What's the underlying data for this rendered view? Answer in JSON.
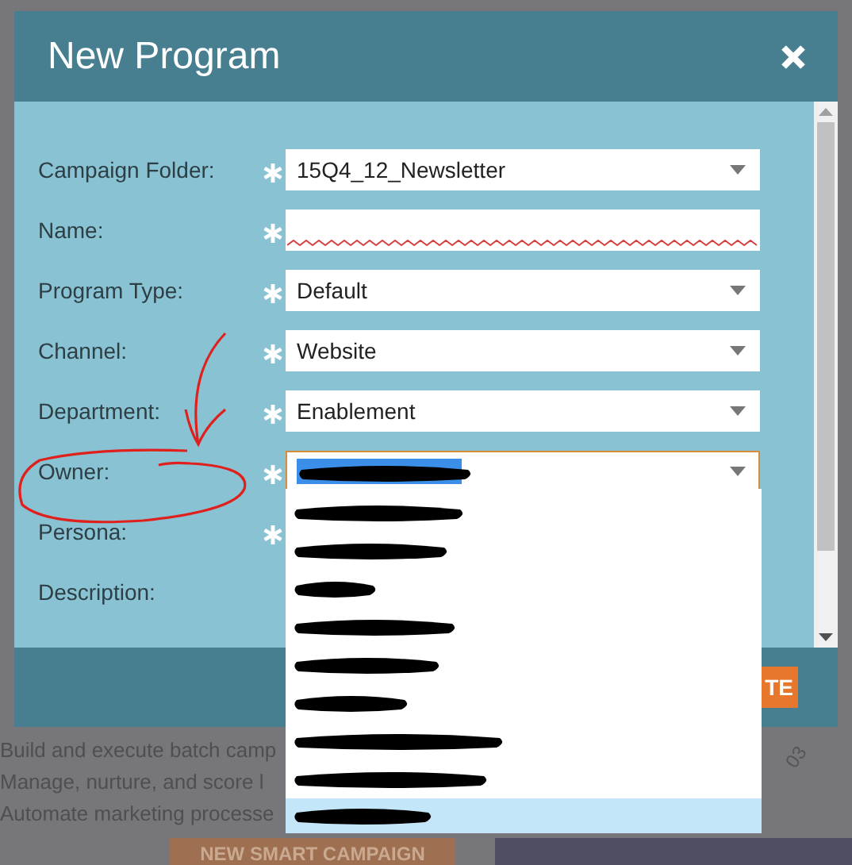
{
  "dialog": {
    "title": "New Program",
    "fields": [
      {
        "label": "Campaign Folder:",
        "required": true,
        "kind": "select",
        "value": "15Q4_12_Newsletter"
      },
      {
        "label": "Name:",
        "required": true,
        "kind": "text",
        "invalid": true
      },
      {
        "label": "Program Type:",
        "required": true,
        "kind": "select",
        "value": "Default"
      },
      {
        "label": "Channel:",
        "required": true,
        "kind": "select",
        "value": "Website"
      },
      {
        "label": "Department:",
        "required": true,
        "kind": "select",
        "value": "Enablement"
      },
      {
        "label": "Owner:",
        "required": true,
        "kind": "select",
        "focused": true,
        "redacted": true
      },
      {
        "label": "Persona:",
        "required": true
      },
      {
        "label": "Description:",
        "required": false
      }
    ],
    "footer_button": "TE"
  },
  "owner_dropdown": {
    "options": [
      {
        "highlighted": false
      },
      {
        "highlighted": false
      },
      {
        "highlighted": false
      },
      {
        "highlighted": false
      },
      {
        "highlighted": false
      },
      {
        "highlighted": false
      },
      {
        "highlighted": false
      },
      {
        "highlighted": false
      },
      {
        "highlighted": true
      }
    ]
  },
  "background": {
    "lines": [
      "Build and execute batch camp",
      "Manage, nurture, and score l",
      "Automate marketing processe"
    ],
    "button": "NEW SMART CAMPAIGN",
    "axis_label": "03"
  }
}
